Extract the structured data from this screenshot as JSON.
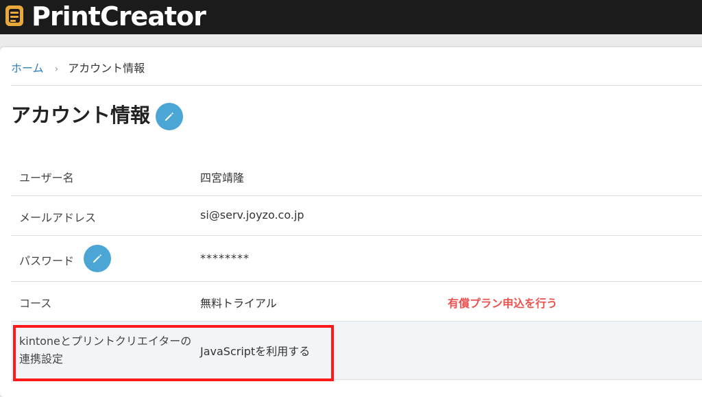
{
  "header": {
    "app_name": "PrintCreator",
    "logo_icon": "printcreator-logo-icon",
    "logo_color": "#e9a93a"
  },
  "breadcrumb": {
    "home": "ホーム",
    "separator": "›",
    "current": "アカウント情報"
  },
  "page": {
    "title": "アカウント情報",
    "edit_icon": "pencil-icon"
  },
  "account": {
    "username": {
      "label": "ユーザー名",
      "value": "四宮靖隆"
    },
    "email": {
      "label": "メールアドレス",
      "value": "si@serv.joyzo.co.jp"
    },
    "password": {
      "label": "パスワード",
      "value": "********"
    },
    "course": {
      "label": "コース",
      "value": "無料トライアル",
      "link": "有償プラン申込を行う"
    },
    "kintone": {
      "label": "kintoneとプリントクリエイターの連携設定",
      "value": "JavaScriptを利用する"
    }
  },
  "colors": {
    "accent": "#4ba6d6",
    "link": "#2f7fba",
    "upgrade": "#e9524f",
    "highlight": "#ff1a1a"
  }
}
